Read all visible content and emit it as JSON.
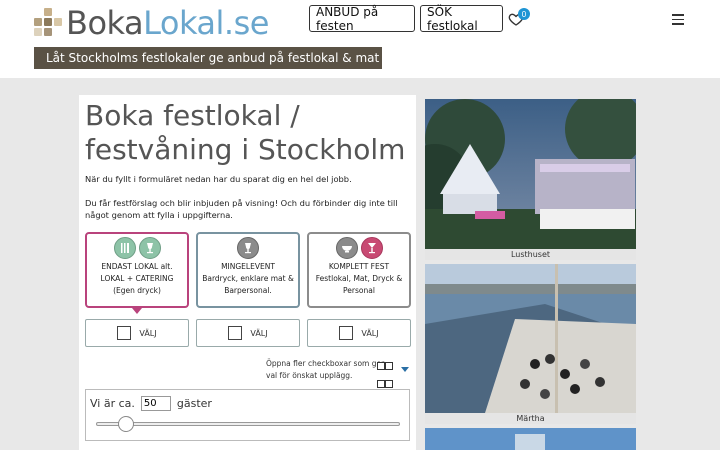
{
  "brand": {
    "part1": "Boka",
    "part2": "Lokal.se"
  },
  "header": {
    "anbud_label": "ANBUD på festen",
    "sok_label": "SÖK festlokal",
    "favorites_count": "0",
    "tagline": "Låt Stockholms festlokaler ge anbud på festlokal & mat"
  },
  "main": {
    "title": "Boka festlokal / festvåning i Stockholm",
    "intro1": "När du fyllt i formuläret nedan har du sparat dig en hel del jobb.",
    "intro2": "Du får festförslag och blir inbjuden på visning! Och du förbinder dig inte till något genom att fylla i uppgifterna.",
    "options": [
      {
        "title": "ENDAST LOKAL alt.",
        "line2": "LOKAL + CATERING",
        "line3": "(Egen dryck)",
        "icons": [
          "cutlery-icon",
          "dining-icon"
        ]
      },
      {
        "title": "MINGELEVENT",
        "line2": "Bardryck, enklare mat &",
        "line3": "Barpersonal.",
        "icons": [
          "wine-glass-icon"
        ]
      },
      {
        "title": "KOMPLETT FEST",
        "line2": "Festlokal, Mat, Dryck &",
        "line3": "Personal",
        "icons": [
          "dish-icon",
          "drinks-icon"
        ]
      }
    ],
    "select_label": "VÄLJ",
    "multi_text": "Öppna fler checkboxar som ger val för önskat upplägg.",
    "guests_prefix": "Vi är ca.",
    "guests_value": "50",
    "guests_suffix": "gäster",
    "guests_slider_fraction": 0.1
  },
  "gallery": [
    {
      "caption": "Lusthuset"
    },
    {
      "caption": "Märtha"
    }
  ],
  "colors": {
    "brand_blue": "#6aa6cd",
    "accent_pink": "#b9437c",
    "tagline_bg": "#5a5245",
    "badge": "#1e95d4"
  }
}
